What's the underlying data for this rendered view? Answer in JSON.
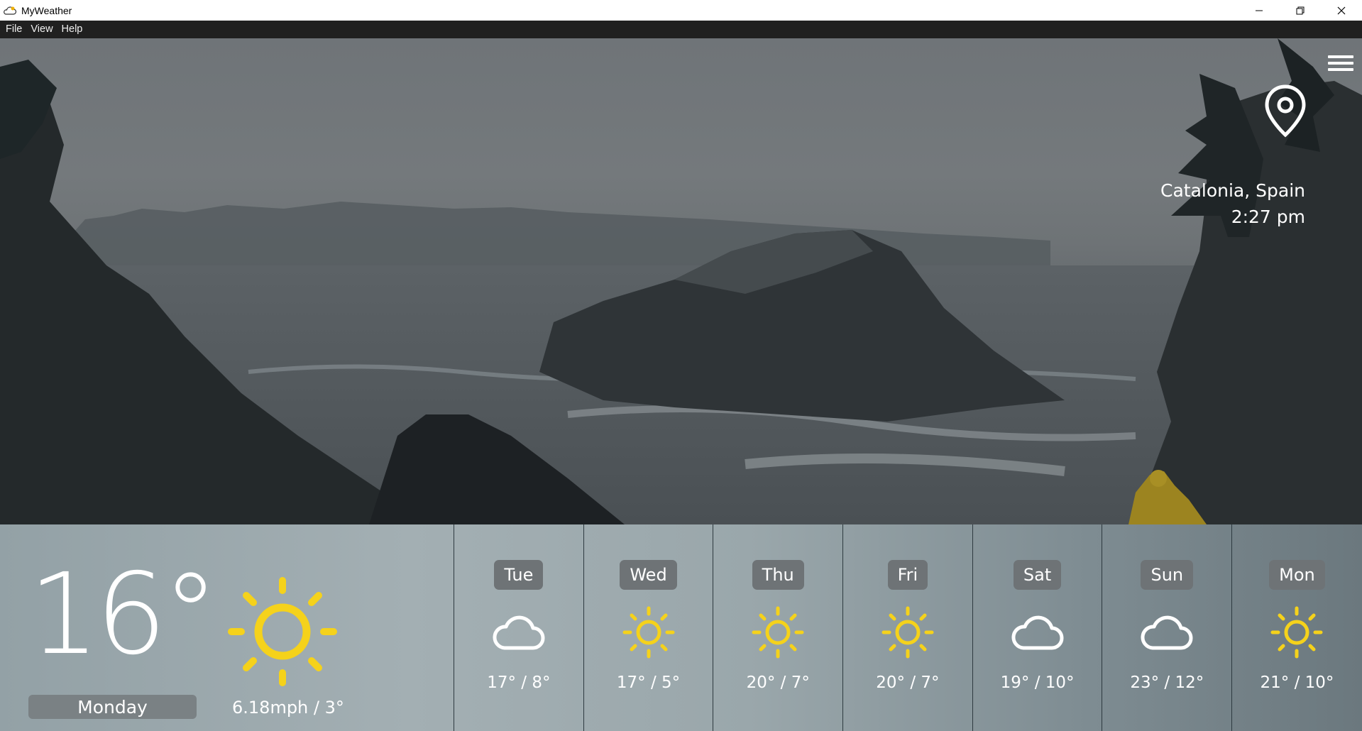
{
  "window": {
    "title": "MyWeather",
    "controls": [
      "minimize",
      "maximize",
      "close"
    ]
  },
  "menu": {
    "items": [
      "File",
      "View",
      "Help"
    ]
  },
  "location": {
    "name": "Catalonia, Spain",
    "time": "2:27 pm"
  },
  "today": {
    "temperature": "16°",
    "day": "Monday",
    "wind": "6.18mph / 3°",
    "icon": "sun-icon"
  },
  "forecast": [
    {
      "day": "Tue",
      "icon": "cloud-icon",
      "temps": "17° / 8°"
    },
    {
      "day": "Wed",
      "icon": "sun-icon",
      "temps": "17° / 5°"
    },
    {
      "day": "Thu",
      "icon": "sun-icon",
      "temps": "20° / 7°"
    },
    {
      "day": "Fri",
      "icon": "sun-icon",
      "temps": "20° / 7°"
    },
    {
      "day": "Sat",
      "icon": "cloud-icon",
      "temps": "19° / 10°"
    },
    {
      "day": "Sun",
      "icon": "cloud-icon",
      "temps": "23° / 12°"
    },
    {
      "day": "Mon",
      "icon": "sun-icon",
      "temps": "21° / 10°"
    }
  ],
  "colors": {
    "sun": "#f5d21b",
    "menubar": "#202020",
    "pill": "#6e7376"
  }
}
